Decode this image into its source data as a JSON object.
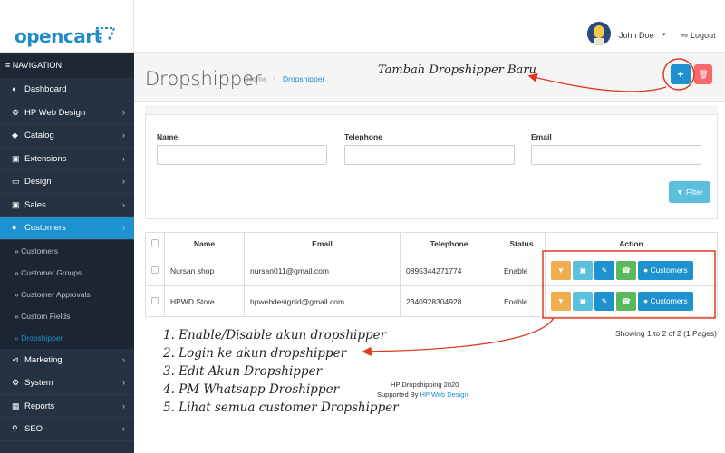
{
  "header": {
    "logo": "opencart",
    "user_name": "John Doe",
    "user_caret": "▾",
    "logout": "Logout"
  },
  "sidebar": {
    "heading": "NAVIGATION",
    "items": [
      {
        "label": "Dashboard",
        "icon": "dashboard-icon"
      },
      {
        "label": "HP Web Design",
        "icon": "cogs-icon"
      },
      {
        "label": "Catalog",
        "icon": "tag-icon"
      },
      {
        "label": "Extensions",
        "icon": "puzzle-icon"
      },
      {
        "label": "Design",
        "icon": "monitor-icon"
      },
      {
        "label": "Sales",
        "icon": "cart-icon"
      },
      {
        "label": "Customers",
        "icon": "user-icon"
      }
    ],
    "sub_items": [
      "Customers",
      "Customer Groups",
      "Customer Approvals",
      "Custom Fields",
      "Dropshipper"
    ],
    "lower_items": [
      {
        "label": "Marketing",
        "icon": "share-icon"
      },
      {
        "label": "System",
        "icon": "cog-icon"
      },
      {
        "label": "Reports",
        "icon": "bar-chart-icon"
      },
      {
        "label": "SEO",
        "icon": "search-icon"
      }
    ]
  },
  "page": {
    "title": "Dropshipper",
    "breadcrumb_home": "Home",
    "breadcrumb_current": "Dropshipper"
  },
  "filter": {
    "name_label": "Name",
    "telephone_label": "Telephone",
    "email_label": "Email",
    "button": "Filter"
  },
  "table": {
    "headers": [
      "Name",
      "Email",
      "Telephone",
      "Status",
      "Action"
    ],
    "rows": [
      {
        "name": "Nursan shop",
        "email": "nursan011@gmail.com",
        "telephone": "0895344271774",
        "status": "Enable"
      },
      {
        "name": "HPWD Store",
        "email": "hpwebdesignid@gmail.com",
        "telephone": "2340928304928",
        "status": "Enable"
      }
    ],
    "customers_button": "Customers"
  },
  "pagination": "Showing 1 to 2 of 2 (1 Pages)",
  "footer": {
    "line1": "HP Dropshipping 2020",
    "line2_prefix": "Supported By ",
    "line2_link": "HP Web Design"
  },
  "annotations": {
    "top": "Tambah Dropshipper Baru",
    "lines": [
      "1. Enable/Disable akun dropshipper",
      "2. Login ke akun dropshipper",
      "3. Edit Akun Dropshipper",
      "4. PM Whatsapp Droshipper",
      "5. Lihat semua customer Dropshipper"
    ]
  },
  "colors": {
    "brand": "#1e91cf",
    "sidebar": "#253241",
    "annotation": "#e0391f"
  }
}
